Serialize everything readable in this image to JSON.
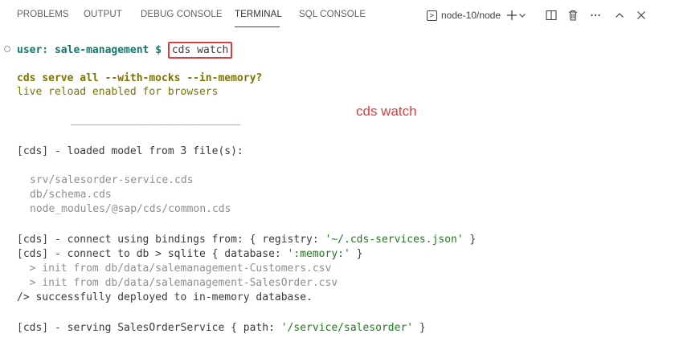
{
  "tabs": [
    {
      "label": "PROBLEMS"
    },
    {
      "label": "OUTPUT"
    },
    {
      "label": "DEBUG CONSOLE"
    },
    {
      "label": "TERMINAL",
      "active": true
    },
    {
      "label": "SQL CONSOLE"
    }
  ],
  "toolbar": {
    "terminal_name": "node-10/node",
    "icons": [
      "terminal-icon",
      "plus-icon",
      "chevron-down-icon",
      "split-icon",
      "trash-icon",
      "more-icon",
      "chevron-up-icon",
      "close-icon"
    ]
  },
  "terminal": {
    "prompt_user": "user: sale-management",
    "prompt_symbol": "$",
    "command": "cds watch",
    "line_serve": "cds serve all --with-mocks --in-memory?",
    "line_reload": "live reload enabled for browsers",
    "separator": "___________________________",
    "loaded": "[cds] - loaded model from 3 file(s):",
    "files": [
      "srv/salesorder-service.cds",
      "db/schema.cds",
      "node_modules/@sap/cds/common.cds"
    ],
    "connect1_prefix": "[cds] - connect using bindings from: { registry: ",
    "connect1_value": "'~/.cds-services.json'",
    "connect1_suffix": " }",
    "connect2_prefix": "[cds] - connect to db > sqlite { database: ",
    "connect2_value": "':memory:'",
    "connect2_suffix": " }",
    "init1": "  > init from db/data/salemanagement-Customers.csv",
    "init2": "  > init from db/data/salemanagement-SalesOrder.csv",
    "deployed": "/> successfully deployed to in-memory database.",
    "serving_prefix": "[cds] - serving SalesOrderService { path: ",
    "serving_value": "'/service/salesorder'",
    "serving_suffix": " }"
  },
  "annotation": "cds watch",
  "colors": {
    "prompt": "#0f7a6c",
    "highlight_border": "#e03a3a",
    "string_value": "#1c7d18",
    "warning_text": "#7c7600"
  }
}
